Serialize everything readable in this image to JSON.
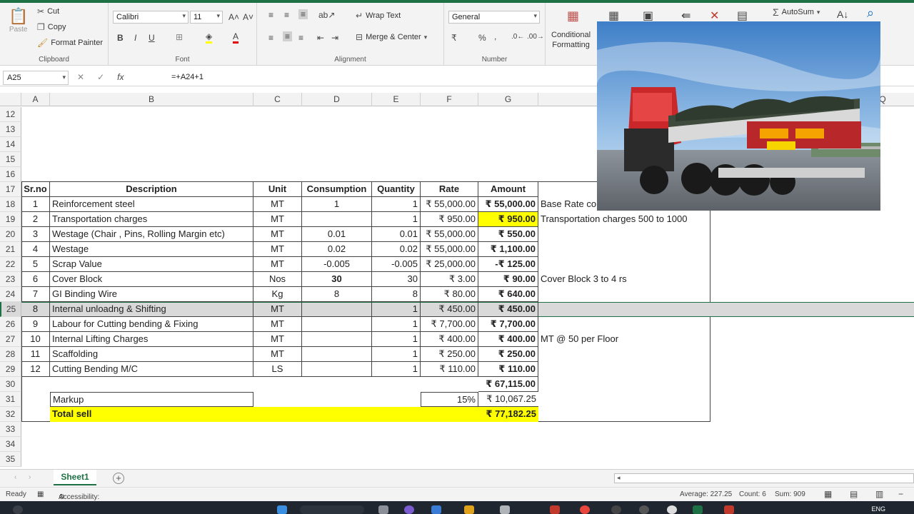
{
  "ribbon": {
    "clipboard": {
      "cut": "Cut",
      "copy": "Copy",
      "format_painter": "Format Painter",
      "paste": "Paste",
      "label": "Clipboard"
    },
    "font": {
      "name": "Calibri",
      "size": "11",
      "bold": "B",
      "italic": "I",
      "underline": "U",
      "label": "Font"
    },
    "alignment": {
      "wrap_text": "Wrap Text",
      "merge_center": "Merge & Center",
      "label": "Alignment"
    },
    "number": {
      "format": "General",
      "percent": "%",
      "comma": ",",
      "label": "Number"
    },
    "styles": {
      "conditional": "Conditional",
      "formatting": "Formatting"
    },
    "editing": {
      "autosum": "AutoSum"
    }
  },
  "formula_bar": {
    "name_box": "A25",
    "formula": "=+A24+1"
  },
  "columns": [
    "A",
    "B",
    "C",
    "D",
    "E",
    "F",
    "G",
    "Q"
  ],
  "rows": [
    "12",
    "13",
    "14",
    "15",
    "16",
    "17",
    "18",
    "19",
    "20",
    "21",
    "22",
    "23",
    "24",
    "25",
    "26",
    "27",
    "28",
    "29",
    "30",
    "31",
    "32",
    "33",
    "34",
    "35"
  ],
  "table": {
    "headers": {
      "srno": "Sr.no",
      "description": "Description",
      "unit": "Unit",
      "consumption": "Consumption",
      "quantity": "Quantity",
      "rate": "Rate",
      "amount": "Amount"
    },
    "items": [
      {
        "sr": "1",
        "desc": "Reinforcement steel",
        "unit": "MT",
        "cons": "1",
        "qty": "1",
        "rate": "₹ 55,000.00",
        "amount": "₹ 55,000.00",
        "note": "Base Rate co"
      },
      {
        "sr": "2",
        "desc": "Transportation charges",
        "unit": "MT",
        "cons": "",
        "qty": "1",
        "rate": "₹ 950.00",
        "amount": "₹ 950.00",
        "note": "Transportation charges 500 to 1000"
      },
      {
        "sr": "3",
        "desc": "Westage (Chair , Pins, Rolling Margin etc)",
        "unit": "MT",
        "cons": "0.01",
        "qty": "0.01",
        "rate": "₹ 55,000.00",
        "amount": "₹ 550.00",
        "note": ""
      },
      {
        "sr": "4",
        "desc": "Westage",
        "unit": "MT",
        "cons": "0.02",
        "qty": "0.02",
        "rate": "₹ 55,000.00",
        "amount": "₹ 1,100.00",
        "note": ""
      },
      {
        "sr": "5",
        "desc": "Scrap Value",
        "unit": "MT",
        "cons": "-0.005",
        "qty": "-0.005",
        "rate": "₹ 25,000.00",
        "amount": "-₹ 125.00",
        "note": ""
      },
      {
        "sr": "6",
        "desc": "Cover Block",
        "unit": "Nos",
        "cons": "30",
        "qty": "30",
        "rate": "₹ 3.00",
        "amount": "₹ 90.00",
        "note": "Cover Block 3 to 4 rs"
      },
      {
        "sr": "7",
        "desc": "GI Binding Wire",
        "unit": "Kg",
        "cons": "8",
        "qty": "8",
        "rate": "₹ 80.00",
        "amount": "₹ 640.00",
        "note": ""
      },
      {
        "sr": "8",
        "desc": "Internal unloadng & Shifting",
        "unit": "MT",
        "cons": "",
        "qty": "1",
        "rate": "₹ 450.00",
        "amount": "₹ 450.00",
        "note": ""
      },
      {
        "sr": "9",
        "desc": "Labour for Cutting bending & Fixing",
        "unit": "MT",
        "cons": "",
        "qty": "1",
        "rate": "₹ 7,700.00",
        "amount": "₹ 7,700.00",
        "note": ""
      },
      {
        "sr": "10",
        "desc": "Internal Lifting Charges",
        "unit": "MT",
        "cons": "",
        "qty": "1",
        "rate": "₹ 400.00",
        "amount": "₹ 400.00",
        "note": "MT @ 50 per Floor"
      },
      {
        "sr": "11",
        "desc": "Scaffolding",
        "unit": "MT",
        "cons": "",
        "qty": "1",
        "rate": "₹ 250.00",
        "amount": "₹ 250.00",
        "note": ""
      },
      {
        "sr": "12",
        "desc": "Cutting Bending M/C",
        "unit": "LS",
        "cons": "",
        "qty": "1",
        "rate": "₹ 110.00",
        "amount": "₹ 110.00",
        "note": ""
      }
    ],
    "subtotal": "₹ 67,115.00",
    "markup": {
      "label": "Markup",
      "percent": "15%",
      "amount": "₹ 10,067.25"
    },
    "total": {
      "label": "Total sell",
      "amount": "₹ 77,182.25"
    }
  },
  "sheet_tab": "Sheet1",
  "status": {
    "ready": "Ready",
    "accessibility": "Accessibility: Good to go",
    "average": "Average: 227.25",
    "count": "Count: 6",
    "sum": "Sum: 909"
  },
  "taskbar": {
    "lang": "ENG"
  },
  "colors": {
    "excel_green": "#1e7145",
    "highlight_yellow": "#ffff00",
    "selected_row": "#d9d9d9"
  }
}
